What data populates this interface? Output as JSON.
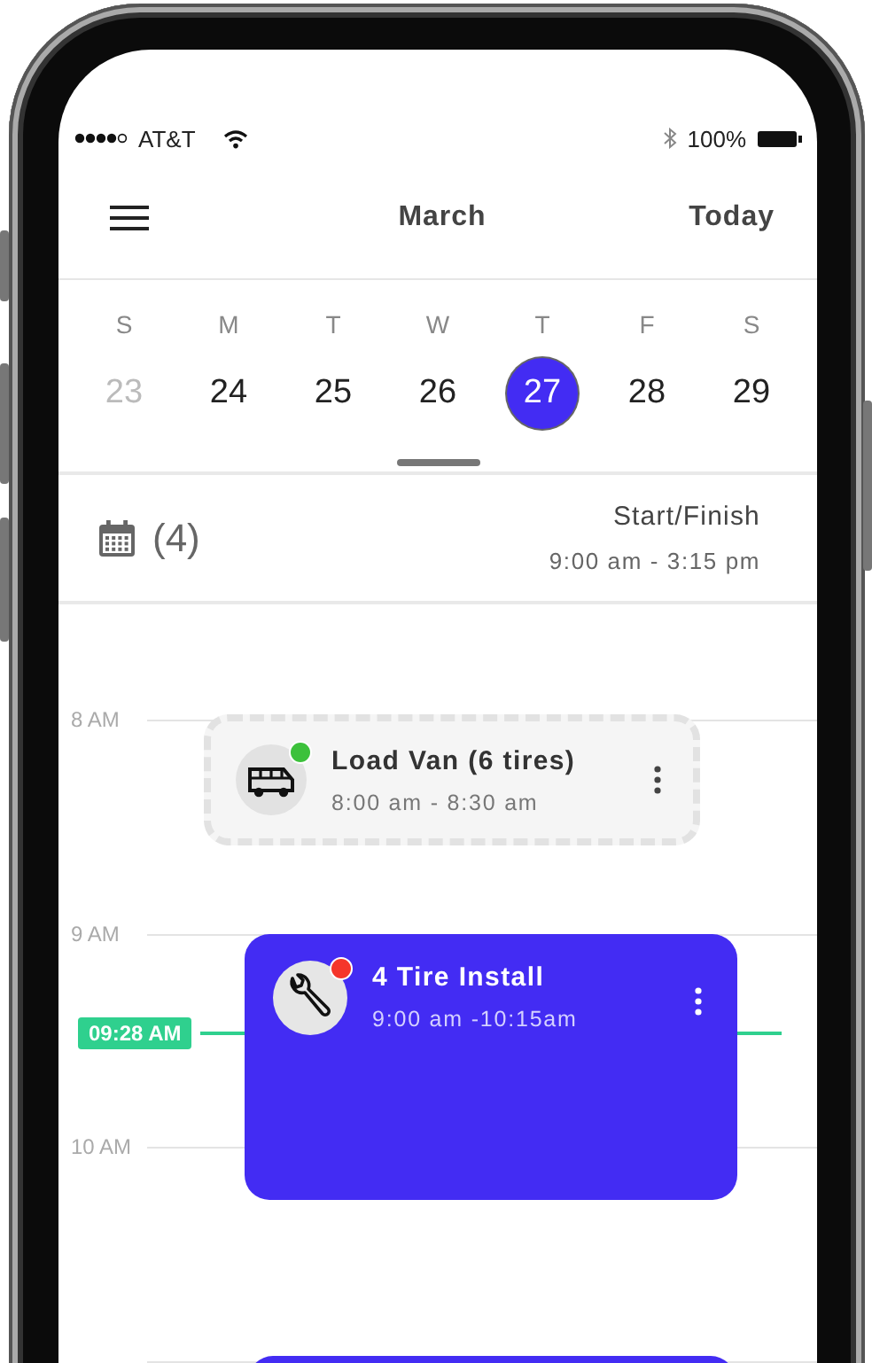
{
  "status_bar": {
    "carrier": "AT&T",
    "battery": "100%"
  },
  "header": {
    "title": "March",
    "action": "Today"
  },
  "week": [
    {
      "letter": "S",
      "date": "23",
      "past": true,
      "selected": false
    },
    {
      "letter": "M",
      "date": "24",
      "past": false,
      "selected": false
    },
    {
      "letter": "T",
      "date": "25",
      "past": false,
      "selected": false
    },
    {
      "letter": "W",
      "date": "26",
      "past": false,
      "selected": false
    },
    {
      "letter": "T",
      "date": "27",
      "past": false,
      "selected": true
    },
    {
      "letter": "F",
      "date": "28",
      "past": false,
      "selected": false
    },
    {
      "letter": "S",
      "date": "29",
      "past": false,
      "selected": false
    }
  ],
  "summary": {
    "count": "(4)",
    "label": "Start/Finish",
    "range": "9:00 am - 3:15 pm"
  },
  "timeline": {
    "hours": [
      "8 AM",
      "9 AM",
      "10 AM"
    ],
    "now": "09:28 AM",
    "events": [
      {
        "kind": "loading",
        "title": "Load Van (6 tires)",
        "time": "8:00 am - 8:30 am",
        "color": "#3cc13b"
      },
      {
        "kind": "install",
        "title": "4 Tire Install",
        "time": "9:00 am -10:15am",
        "color": "#f5352a"
      },
      {
        "kind": "install"
      }
    ]
  }
}
